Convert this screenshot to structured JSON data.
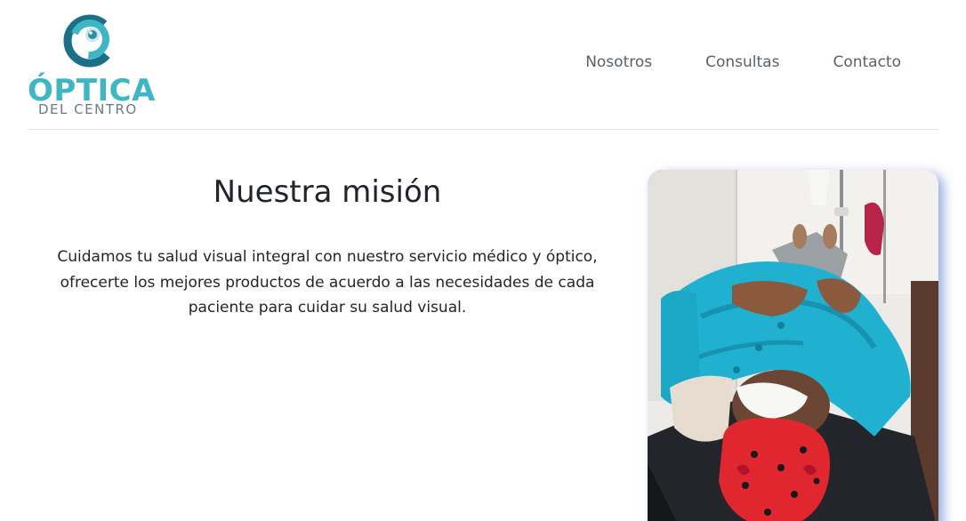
{
  "brand": {
    "name": "ÓPTICA",
    "subtitle": "DEL CENTRO",
    "primary_color": "#3fb6c4",
    "dark_color": "#1b6f86"
  },
  "nav": {
    "items": [
      {
        "label": "Nosotros"
      },
      {
        "label": "Consultas"
      },
      {
        "label": "Contacto"
      }
    ]
  },
  "mission": {
    "title": "Nuestra misión",
    "text": "Cuidamos tu salud visual integral con nuestro servicio médico y óptico, ofrecerte los mejores productos de acuerdo a las necesidades de cada paciente para cuidar su salud visual."
  },
  "photo": {
    "subject": "patient-after-eye-surgery"
  }
}
